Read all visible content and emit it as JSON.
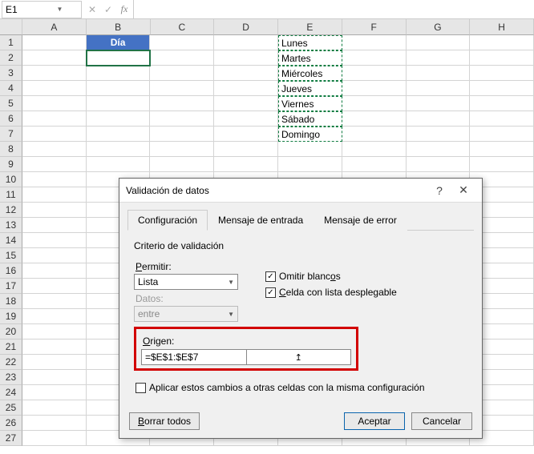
{
  "name_box": "E1",
  "formula": "",
  "columns": [
    "A",
    "B",
    "C",
    "D",
    "E",
    "F",
    "G",
    "H"
  ],
  "row_count": 27,
  "header_cell": {
    "col": "B",
    "row": 1,
    "text": "Día"
  },
  "selected_cell": {
    "col": "B",
    "row": 2
  },
  "list_range": {
    "col": "E",
    "start": 1,
    "end": 7,
    "values": [
      "Lunes",
      "Martes",
      "Miércoles",
      "Jueves",
      "Viernes",
      "Sábado",
      "Domingo"
    ]
  },
  "dialog": {
    "title": "Validación de datos",
    "help_label": "?",
    "close_label": "✕",
    "tabs": [
      "Configuración",
      "Mensaje de entrada",
      "Mensaje de error"
    ],
    "active_tab": 0,
    "criteria_label": "Criterio de validación",
    "allow_label": "Permitir:",
    "allow_value": "Lista",
    "data_label": "Datos:",
    "data_value": "entre",
    "omit_label_pre": "Omitir blanc",
    "omit_label_key": "o",
    "omit_label_post": "s",
    "dropdown_label_key": "C",
    "dropdown_label_post": "elda con lista desplegable",
    "origin_label": "Origen:",
    "origin_value": "=$E$1:$E$7",
    "apply_label": "Aplicar estos cambios a otras celdas con la misma configuración",
    "clear_key": "B",
    "clear_post": "orrar todos",
    "accept": "Aceptar",
    "cancel": "Cancelar"
  }
}
